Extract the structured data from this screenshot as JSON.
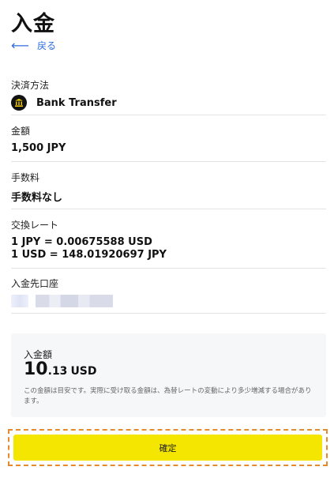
{
  "header": {
    "title": "入金",
    "back_label": "戻る"
  },
  "payment_method": {
    "label": "決済方法",
    "value": "Bank Transfer"
  },
  "amount": {
    "label": "金額",
    "value": "1,500 JPY"
  },
  "fee": {
    "label": "手数料",
    "value": "手数料なし"
  },
  "exchange_rate": {
    "label": "交換レート",
    "line1": "1 JPY = 0.00675588 USD",
    "line2": "1 USD = 148.01920697 JPY"
  },
  "destination": {
    "label": "入金先口座"
  },
  "summary": {
    "label": "入金額",
    "amount_int": "10",
    "amount_dec": ".13",
    "currency": "USD",
    "note": "この金額は目安です。実際に受け取る金額は、為替レートの変動により多少増減する場合があります。"
  },
  "actions": {
    "confirm_label": "確定"
  },
  "colors": {
    "accent": "#f4e600",
    "link": "#2f6fde",
    "highlight_border": "#e58a2d"
  }
}
